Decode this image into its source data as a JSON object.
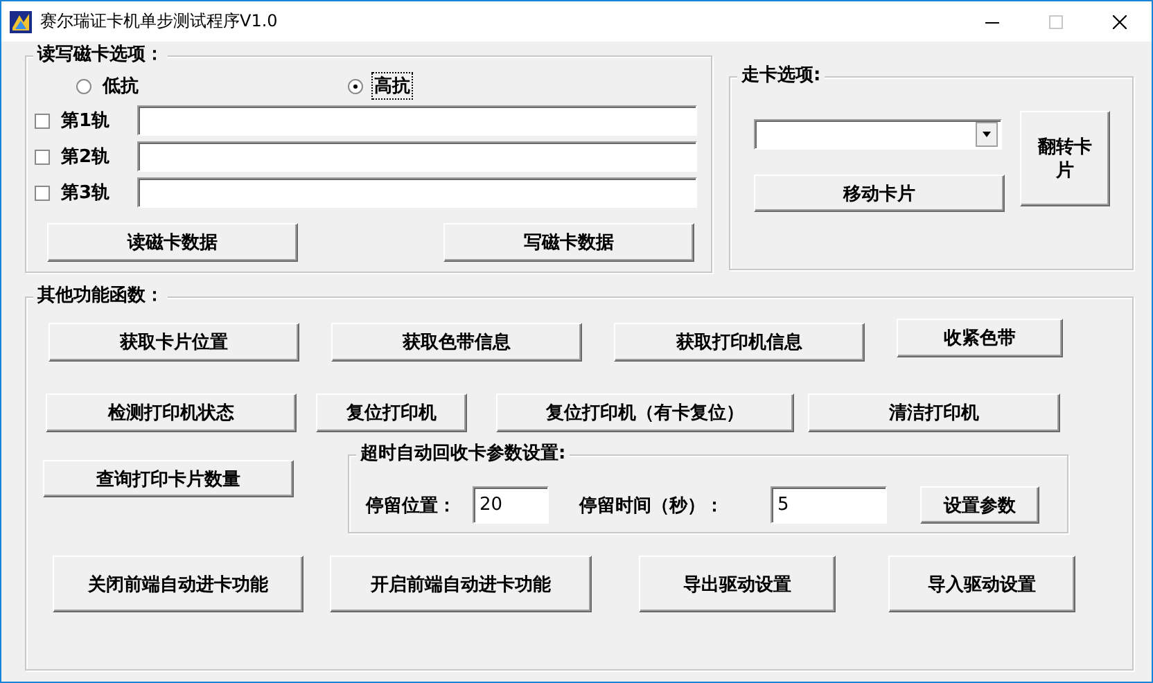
{
  "window": {
    "title": "赛尔瑞证卡机单步测试程序V1.0"
  },
  "magnetic_options": {
    "title": "读写磁卡选项：",
    "radios": [
      {
        "label": "低抗",
        "selected": false,
        "focused": false
      },
      {
        "label": "高抗",
        "selected": true,
        "focused": true
      }
    ],
    "tracks": [
      {
        "label": "第1轨",
        "checked": false
      },
      {
        "label": "第2轨",
        "checked": false
      },
      {
        "label": "第3轨",
        "checked": false
      }
    ],
    "buttons": [
      "读磁卡数据",
      "写磁卡数据"
    ]
  },
  "card_move": {
    "title": "走卡选项:",
    "move_button": "移动卡片",
    "flip_button": "翻转卡片"
  },
  "functions": {
    "title": "其他功能函数：",
    "rows": [
      [
        "获取卡片位置",
        "获取色带信息",
        "获取打印机信息",
        "收紧色带"
      ],
      [
        "检测打印机状态",
        "复位打印机",
        "复位打印机（有卡复位）",
        "清洁打印机"
      ]
    ],
    "query_button": "查询打印卡片数量",
    "timeout": {
      "title": "超时自动回收卡参数设置:",
      "fields": [
        {
          "label": "停留位置：",
          "value": "20"
        },
        {
          "label": "停留时间（秒）：",
          "value": "5"
        }
      ],
      "button": "设置参数"
    },
    "bottom_buttons": [
      "关闭前端自动进卡功能",
      "开启前端自动进卡功能",
      "导出驱动设置",
      "导入驱动设置"
    ]
  }
}
